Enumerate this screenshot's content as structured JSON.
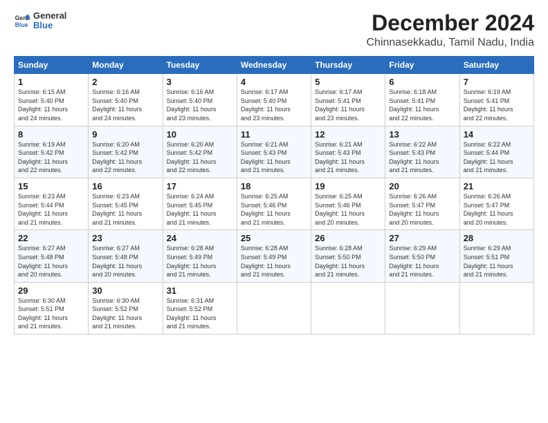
{
  "logo": {
    "general": "General",
    "blue": "Blue"
  },
  "title": "December 2024",
  "location": "Chinnasekkadu, Tamil Nadu, India",
  "days_of_week": [
    "Sunday",
    "Monday",
    "Tuesday",
    "Wednesday",
    "Thursday",
    "Friday",
    "Saturday"
  ],
  "weeks": [
    [
      {
        "day": 1,
        "info": "Sunrise: 6:15 AM\nSunset: 5:40 PM\nDaylight: 11 hours\nand 24 minutes."
      },
      {
        "day": 2,
        "info": "Sunrise: 6:16 AM\nSunset: 5:40 PM\nDaylight: 11 hours\nand 24 minutes."
      },
      {
        "day": 3,
        "info": "Sunrise: 6:16 AM\nSunset: 5:40 PM\nDaylight: 11 hours\nand 23 minutes."
      },
      {
        "day": 4,
        "info": "Sunrise: 6:17 AM\nSunset: 5:40 PM\nDaylight: 11 hours\nand 23 minutes."
      },
      {
        "day": 5,
        "info": "Sunrise: 6:17 AM\nSunset: 5:41 PM\nDaylight: 11 hours\nand 23 minutes."
      },
      {
        "day": 6,
        "info": "Sunrise: 6:18 AM\nSunset: 5:41 PM\nDaylight: 11 hours\nand 22 minutes."
      },
      {
        "day": 7,
        "info": "Sunrise: 6:19 AM\nSunset: 5:41 PM\nDaylight: 11 hours\nand 22 minutes."
      }
    ],
    [
      {
        "day": 8,
        "info": "Sunrise: 6:19 AM\nSunset: 5:42 PM\nDaylight: 11 hours\nand 22 minutes."
      },
      {
        "day": 9,
        "info": "Sunrise: 6:20 AM\nSunset: 5:42 PM\nDaylight: 11 hours\nand 22 minutes."
      },
      {
        "day": 10,
        "info": "Sunrise: 6:20 AM\nSunset: 5:42 PM\nDaylight: 11 hours\nand 22 minutes."
      },
      {
        "day": 11,
        "info": "Sunrise: 6:21 AM\nSunset: 5:43 PM\nDaylight: 11 hours\nand 21 minutes."
      },
      {
        "day": 12,
        "info": "Sunrise: 6:21 AM\nSunset: 5:43 PM\nDaylight: 11 hours\nand 21 minutes."
      },
      {
        "day": 13,
        "info": "Sunrise: 6:22 AM\nSunset: 5:43 PM\nDaylight: 11 hours\nand 21 minutes."
      },
      {
        "day": 14,
        "info": "Sunrise: 6:22 AM\nSunset: 5:44 PM\nDaylight: 11 hours\nand 21 minutes."
      }
    ],
    [
      {
        "day": 15,
        "info": "Sunrise: 6:23 AM\nSunset: 5:44 PM\nDaylight: 11 hours\nand 21 minutes."
      },
      {
        "day": 16,
        "info": "Sunrise: 6:23 AM\nSunset: 5:45 PM\nDaylight: 11 hours\nand 21 minutes."
      },
      {
        "day": 17,
        "info": "Sunrise: 6:24 AM\nSunset: 5:45 PM\nDaylight: 11 hours\nand 21 minutes."
      },
      {
        "day": 18,
        "info": "Sunrise: 6:25 AM\nSunset: 5:46 PM\nDaylight: 11 hours\nand 21 minutes."
      },
      {
        "day": 19,
        "info": "Sunrise: 6:25 AM\nSunset: 5:46 PM\nDaylight: 11 hours\nand 20 minutes."
      },
      {
        "day": 20,
        "info": "Sunrise: 6:26 AM\nSunset: 5:47 PM\nDaylight: 11 hours\nand 20 minutes."
      },
      {
        "day": 21,
        "info": "Sunrise: 6:26 AM\nSunset: 5:47 PM\nDaylight: 11 hours\nand 20 minutes."
      }
    ],
    [
      {
        "day": 22,
        "info": "Sunrise: 6:27 AM\nSunset: 5:48 PM\nDaylight: 11 hours\nand 20 minutes."
      },
      {
        "day": 23,
        "info": "Sunrise: 6:27 AM\nSunset: 5:48 PM\nDaylight: 11 hours\nand 20 minutes."
      },
      {
        "day": 24,
        "info": "Sunrise: 6:28 AM\nSunset: 5:49 PM\nDaylight: 11 hours\nand 21 minutes."
      },
      {
        "day": 25,
        "info": "Sunrise: 6:28 AM\nSunset: 5:49 PM\nDaylight: 11 hours\nand 21 minutes."
      },
      {
        "day": 26,
        "info": "Sunrise: 6:28 AM\nSunset: 5:50 PM\nDaylight: 11 hours\nand 21 minutes."
      },
      {
        "day": 27,
        "info": "Sunrise: 6:29 AM\nSunset: 5:50 PM\nDaylight: 11 hours\nand 21 minutes."
      },
      {
        "day": 28,
        "info": "Sunrise: 6:29 AM\nSunset: 5:51 PM\nDaylight: 11 hours\nand 21 minutes."
      }
    ],
    [
      {
        "day": 29,
        "info": "Sunrise: 6:30 AM\nSunset: 5:51 PM\nDaylight: 11 hours\nand 21 minutes."
      },
      {
        "day": 30,
        "info": "Sunrise: 6:30 AM\nSunset: 5:52 PM\nDaylight: 11 hours\nand 21 minutes."
      },
      {
        "day": 31,
        "info": "Sunrise: 6:31 AM\nSunset: 5:52 PM\nDaylight: 11 hours\nand 21 minutes."
      },
      null,
      null,
      null,
      null
    ]
  ]
}
